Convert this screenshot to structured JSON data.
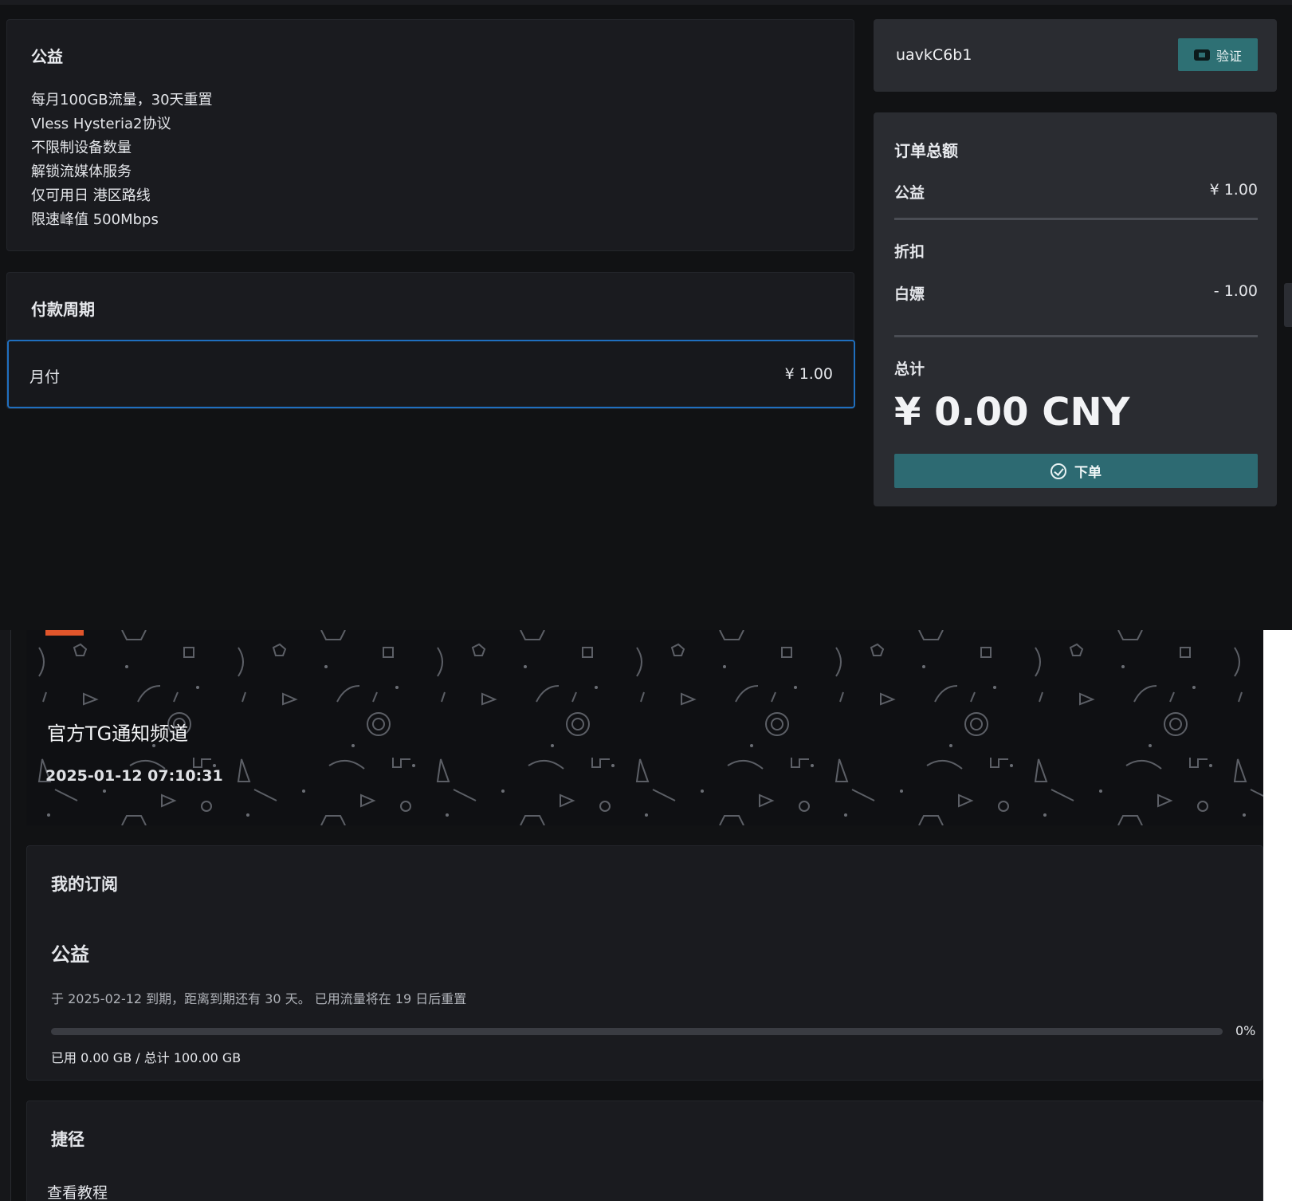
{
  "plan": {
    "title": "公益",
    "features": [
      "每月100GB流量，30天重置",
      "Vless Hysteria2协议",
      "不限制设备数量",
      "解锁流媒体服务",
      "仅可用日 港区路线",
      "限速峰值 500Mbps"
    ]
  },
  "period": {
    "title": "付款周期",
    "option_label": "月付",
    "option_price": "¥ 1.00"
  },
  "coupon": {
    "code": "uavkC6b1",
    "verify_label": "验证"
  },
  "order": {
    "title": "订单总额",
    "item_label": "公益",
    "item_price": "¥ 1.00",
    "discount_title": "折扣",
    "discount_label": "白嫖",
    "discount_value": "- 1.00",
    "total_label": "总计",
    "total_value": "¥ 0.00 CNY",
    "submit_label": "下单"
  },
  "banner": {
    "title": "官方TG通知频道",
    "date": "2025-01-12 07:10:31"
  },
  "subscription": {
    "heading": "我的订阅",
    "plan_name": "公益",
    "expire_text": "于 2025-02-12 到期，距离到期还有 30 天。 已用流量将在 19 日后重置",
    "progress_percent": 0,
    "progress_label": "0%",
    "usage_text": "已用 0.00 GB / 总计 100.00 GB"
  },
  "shortcuts": {
    "heading": "捷径",
    "tutorial_label": "查看教程"
  },
  "colors": {
    "accent_teal": "#2d6a72",
    "selected_border": "#1f6fbf",
    "banner_accent": "#e0552b"
  }
}
